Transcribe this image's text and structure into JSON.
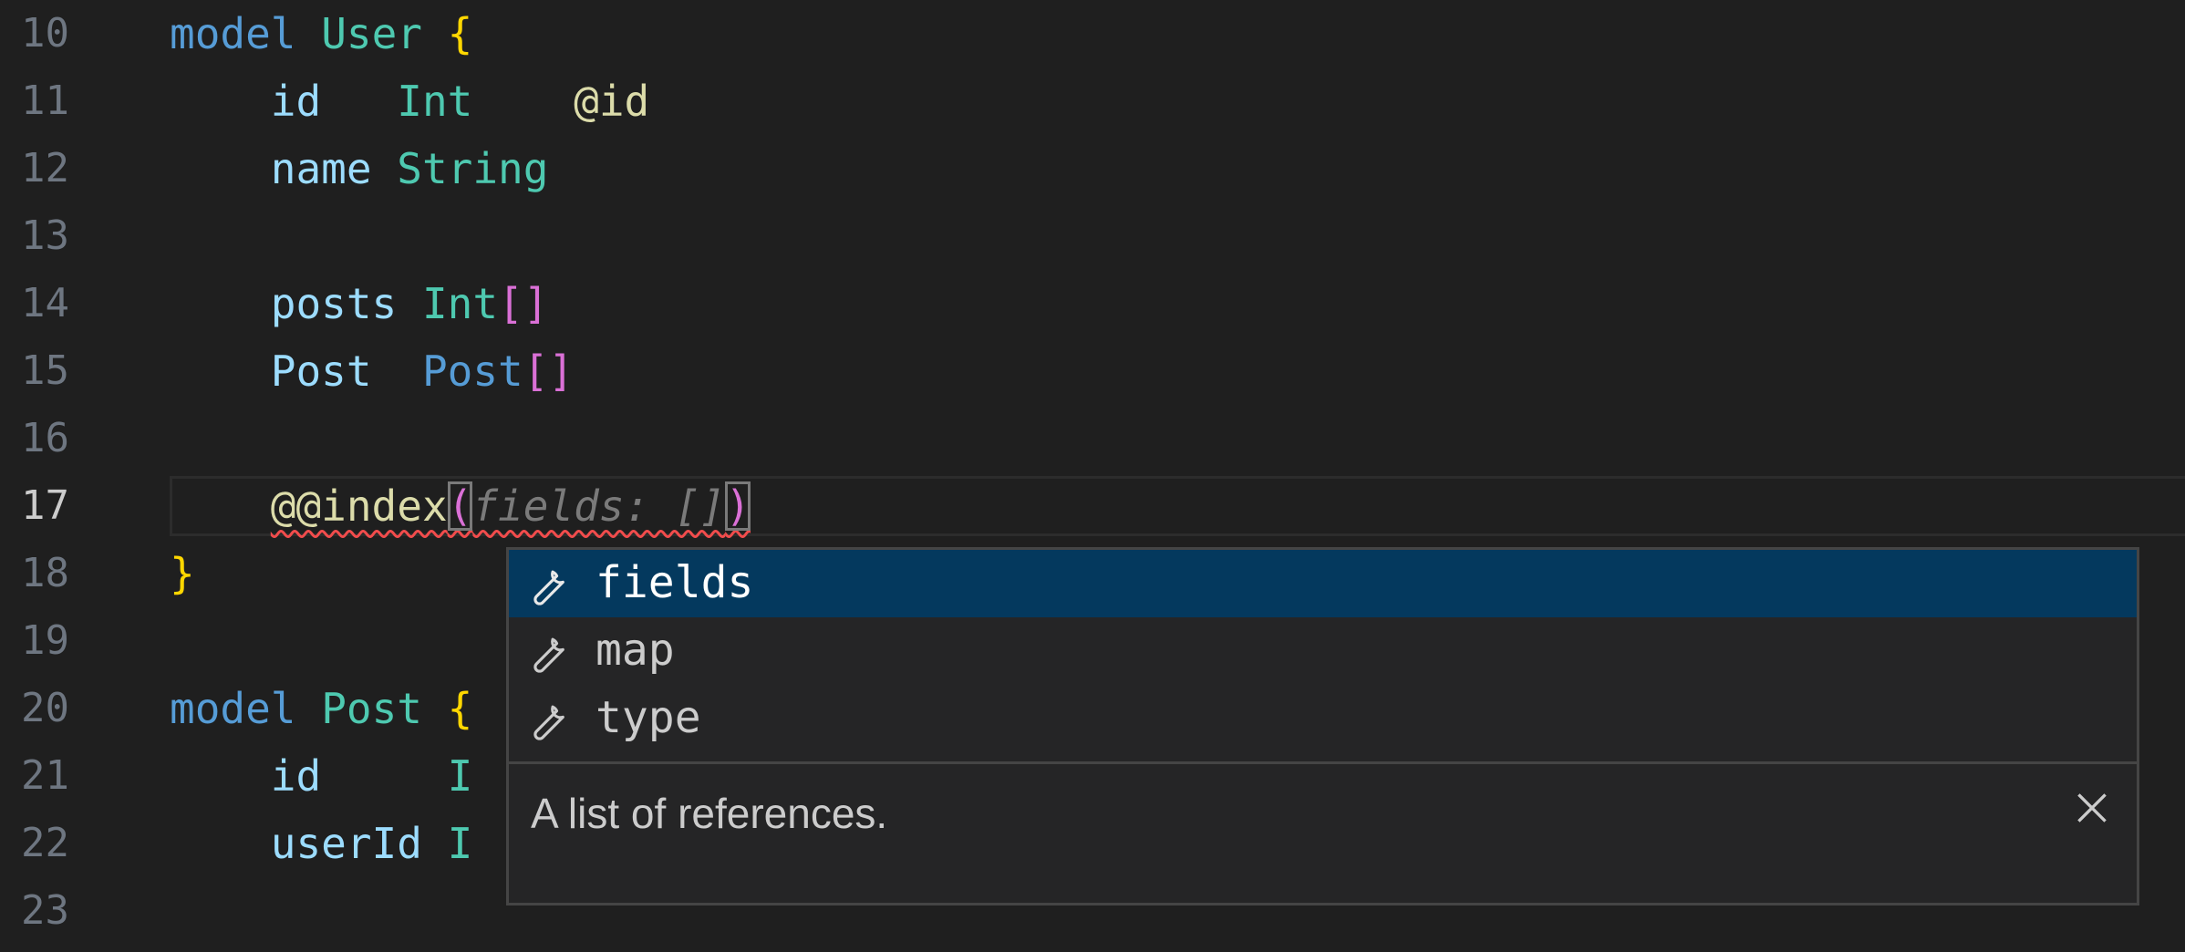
{
  "lines": [
    {
      "n": "10"
    },
    {
      "n": "11"
    },
    {
      "n": "12"
    },
    {
      "n": "13"
    },
    {
      "n": "14"
    },
    {
      "n": "15"
    },
    {
      "n": "16"
    },
    {
      "n": "17"
    },
    {
      "n": "18"
    },
    {
      "n": "19"
    },
    {
      "n": "20"
    },
    {
      "n": "21"
    },
    {
      "n": "22"
    },
    {
      "n": "23"
    }
  ],
  "tokens": {
    "l10": {
      "kw": "model",
      "name": "User",
      "brace": "{"
    },
    "l11": {
      "field": "id",
      "type": "Int",
      "attr": "@id"
    },
    "l12": {
      "field": "name",
      "type": "String"
    },
    "l14": {
      "field": "posts",
      "type": "Int",
      "br": "[]"
    },
    "l15": {
      "field": "Post",
      "type": "Post",
      "br": "[]"
    },
    "l17": {
      "attr": "@@index",
      "open": "(",
      "hint": "fields: []",
      "close": ")"
    },
    "l18": {
      "brace": "}"
    },
    "l20": {
      "kw": "model",
      "name": "Post",
      "brace": "{"
    },
    "l21": {
      "field": "id",
      "type": "I"
    },
    "l22": {
      "field": "userId",
      "type": "I"
    }
  },
  "suggest": {
    "items": [
      {
        "label": "fields",
        "icon": "wrench-icon",
        "selected": true
      },
      {
        "label": "map",
        "icon": "wrench-icon"
      },
      {
        "label": "type",
        "icon": "wrench-icon"
      }
    ],
    "doc": "A list of references."
  },
  "colors": {
    "background": "#1f1f1f",
    "keyword": "#569cd6",
    "type": "#4ec9b0",
    "field": "#9cdcfe",
    "bracket": "#ffd700",
    "bracket2": "#da70d6",
    "attribute": "#dcdcaa",
    "selection": "#04395e",
    "error": "#f14c4c"
  }
}
